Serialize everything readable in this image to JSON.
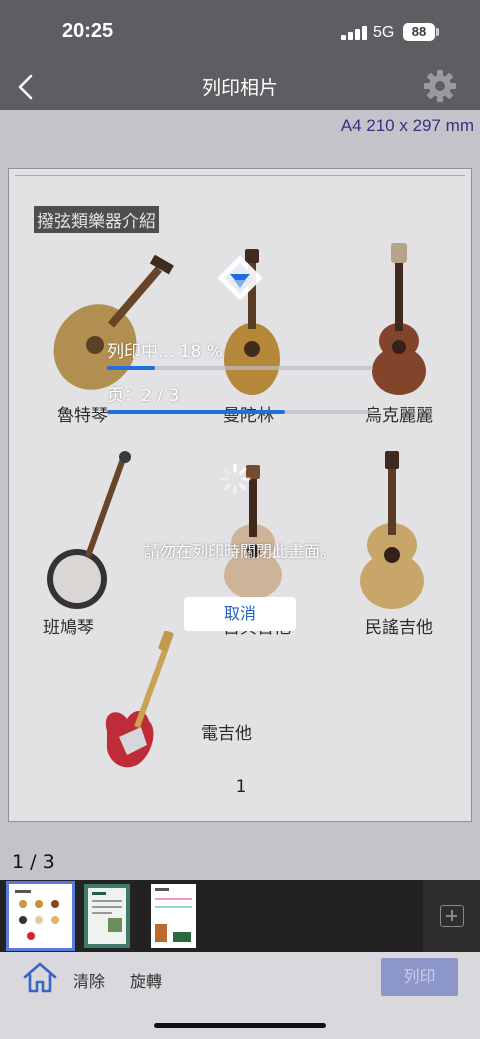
{
  "status_bar": {
    "time": "20:25",
    "network": "5G",
    "battery": "88"
  },
  "nav": {
    "title": "列印相片",
    "back_icon": "chevron-left-icon",
    "settings_icon": "gear-icon"
  },
  "paper_size": "A4 210 x 297 mm",
  "document": {
    "heading": "撥弦類樂器介紹",
    "instruments": [
      "魯特琴",
      "曼陀林",
      "烏克麗麗",
      "班鳩琴",
      "古典吉他",
      "民謠吉他",
      "電吉他"
    ],
    "page_number": "1"
  },
  "progress": {
    "status_text": "列印中...  18 %",
    "percent": 18,
    "page_text": "页：2 / 3",
    "page_fraction": 0.67,
    "warning": "請勿在列印時關閉此畫面。",
    "cancel_label": "取消"
  },
  "pages": {
    "indicator": "1 / 3",
    "count": 3,
    "selected": 1
  },
  "toolbar": {
    "home_icon": "home-icon",
    "clear_label": "清除",
    "rotate_label": "旋轉",
    "print_label": "列印"
  },
  "colors": {
    "accent": "#1f6fe0",
    "header": "#5e5e62",
    "print_button": "#8c96c9"
  }
}
